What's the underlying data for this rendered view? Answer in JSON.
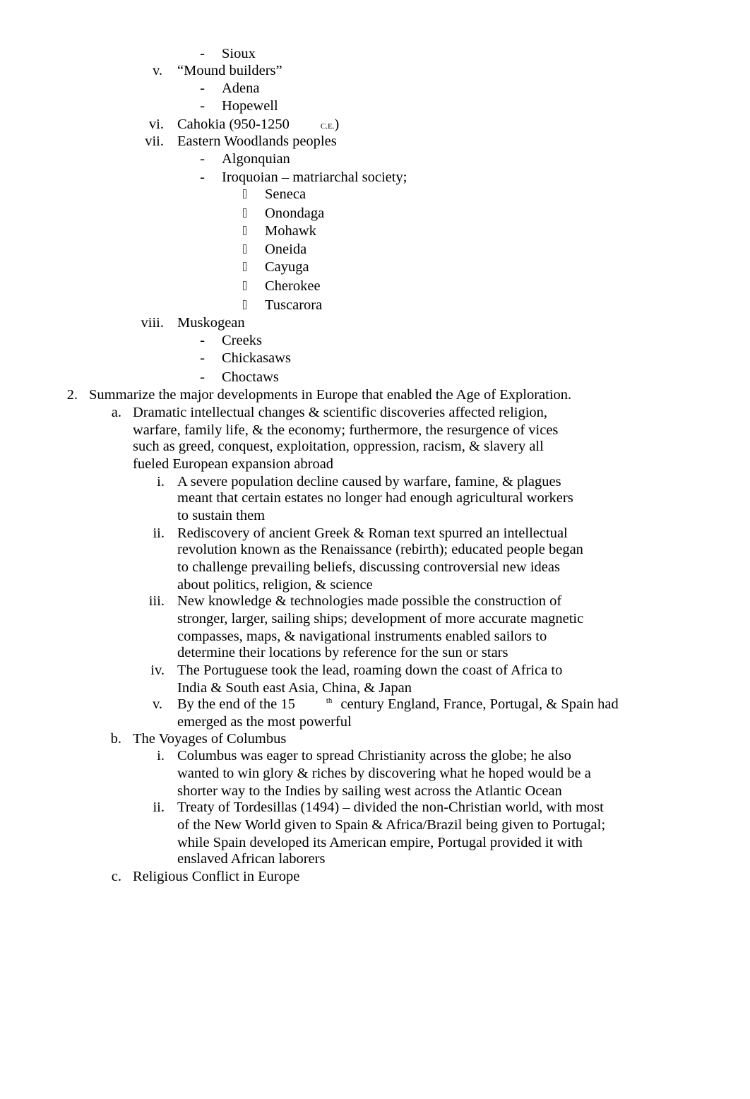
{
  "document": {
    "top_continuation": [
      {
        "marker": "-",
        "text": "Sioux"
      }
    ],
    "roman_items_part1": [
      {
        "marker": "v.",
        "text": "“Mound builders”",
        "children": [
          {
            "marker": "-",
            "text": "Adena"
          },
          {
            "marker": "-",
            "text": "Hopewell"
          }
        ]
      },
      {
        "marker": "vi.",
        "text_before": "Cahokia (950-1250",
        "small_caps": "C.E.",
        "text_after": ")"
      },
      {
        "marker": "vii.",
        "text": "Eastern Woodlands peoples",
        "children": [
          {
            "marker": "-",
            "text": "Algonquian"
          },
          {
            "marker": "-",
            "text": "Iroquoian – matriarchal society;",
            "children": [
              {
                "bullet": "missing-glyph",
                "text": "Seneca"
              },
              {
                "bullet": "missing-glyph",
                "text": "Onondaga"
              },
              {
                "bullet": "missing-glyph",
                "text": "Mohawk"
              },
              {
                "bullet": "missing-glyph",
                "text": "Oneida"
              },
              {
                "bullet": "missing-glyph",
                "text": "Cayuga"
              },
              {
                "bullet": "missing-glyph",
                "text": "Cherokee"
              },
              {
                "bullet": "missing-glyph",
                "text": "Tuscarora"
              }
            ]
          }
        ]
      },
      {
        "marker": "viii.",
        "text": "Muskogean",
        "children": [
          {
            "marker": "-",
            "text": "Creeks"
          },
          {
            "marker": "-",
            "text": "Chickasaws"
          },
          {
            "marker": "-",
            "text": "Choctaws"
          }
        ]
      }
    ],
    "question_2": {
      "marker": "2.",
      "text": "Summarize the major developments in Europe that enabled the Age of Exploration.",
      "items": [
        {
          "marker": "a.",
          "lines": [
            "Dramatic intellectual changes & scientific discoveries affected religion,",
            "warfare, family life, & the economy; furthermore, the resurgence of vices",
            "such as greed, conquest, exploitation, oppression, racism, & slavery all",
            "fueled European expansion abroad"
          ],
          "subitems": [
            {
              "marker": "i.",
              "lines": [
                "A severe population decline caused by warfare, famine, & plagues",
                "meant that certain estates no longer had enough agricultural workers",
                "to sustain them"
              ]
            },
            {
              "marker": "ii.",
              "lines": [
                "Rediscovery of ancient Greek & Roman text spurred an intellectual",
                "revolution known as the Renaissance (rebirth); educated people began",
                "to challenge prevailing beliefs, discussing controversial new ideas",
                "about politics, religion, & science"
              ]
            },
            {
              "marker": "iii.",
              "lines": [
                "New knowledge & technologies made possible the construction of",
                "stronger, larger, sailing ships; development of more accurate magnetic",
                "compasses, maps, & navigational instruments enabled sailors to",
                "determine their locations by reference for the sun or stars"
              ]
            },
            {
              "marker": "iv.",
              "lines": [
                "The Portuguese took the lead, roaming down the coast of Africa to",
                "India & South east Asia, China, & Japan"
              ]
            },
            {
              "marker": "v.",
              "line1_before": "By the end of the 15",
              "line1_sup": "th",
              "line1_after": "century England, France, Portugal, & Spain had",
              "line2": "emerged as the most powerful"
            }
          ]
        },
        {
          "marker": "b.",
          "lines": [
            "The Voyages of Columbus"
          ],
          "subitems": [
            {
              "marker": "i.",
              "lines": [
                "Columbus was eager to spread Christianity across the globe; he also",
                "wanted to win glory & riches by discovering what he hoped would be a",
                "shorter way to the Indies by sailing west across the Atlantic Ocean"
              ]
            },
            {
              "marker": "ii.",
              "lines": [
                "Treaty of Tordesillas (1494) – divided the non-Christian world, with most",
                "of the New World given to Spain & Africa/Brazil being given to Portugal;",
                "while Spain developed its American empire, Portugal provided it with",
                "enslaved African laborers"
              ]
            }
          ]
        },
        {
          "marker": "c.",
          "lines": [
            "Religious Conflict in Europe"
          ]
        }
      ]
    }
  }
}
